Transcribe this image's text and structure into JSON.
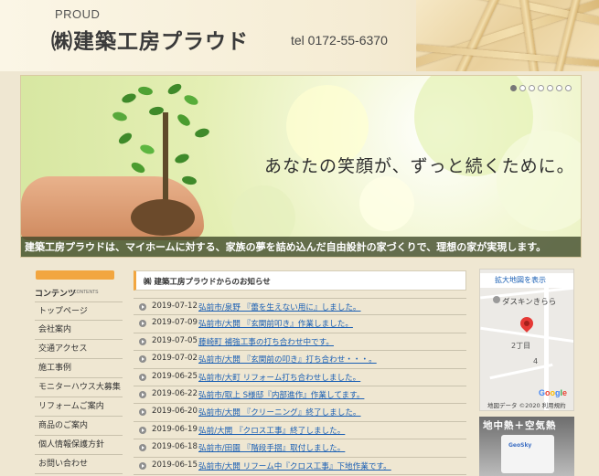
{
  "header": {
    "proud": "PROUD",
    "company": "㈱建築工房プラウド",
    "tel": "tel 0172-55-6370"
  },
  "hero": {
    "tagline": "あなたの笑顔が、ずっと続くために。",
    "strip": "建築工房プラウドは、マイホームに対する、家族の夢を詰め込んだ自由設計の家づくりで、理想の家が実現します。",
    "slide_count": 7,
    "active_slide": 1
  },
  "sidebar": {
    "heading": "コンテンツ",
    "heading_sub": "CONTENTS",
    "items": [
      {
        "label": "トップページ"
      },
      {
        "label": "会社案内"
      },
      {
        "label": "交通アクセス"
      },
      {
        "label": "施工事例"
      },
      {
        "label": "モニターハウス大募集"
      },
      {
        "label": "リフォームご案内"
      },
      {
        "label": "商品のご案内"
      },
      {
        "label": "個人情報保護方針"
      },
      {
        "label": "お問い合わせ"
      }
    ]
  },
  "news": {
    "title": "㈱ 建築工房プラウドからのお知らせ",
    "items": [
      {
        "date": "2019-07-12",
        "text": "弘前市/泉野 『蕾を生えない用に』しました。"
      },
      {
        "date": "2019-07-09",
        "text": "弘前市/大開 『玄関前叩き』作業しました。"
      },
      {
        "date": "2019-07-05",
        "text": "藤崎町 補強工事の打ち合わせ中です。"
      },
      {
        "date": "2019-07-02",
        "text": "弘前市/大開 『玄関前の叩き』打ち合わせ・・・。"
      },
      {
        "date": "2019-06-25",
        "text": "弘前市/大町 リフォーム打ち合わせしました。"
      },
      {
        "date": "2019-06-22",
        "text": "弘前市/取上 S様邸『内部進作』作業してます。"
      },
      {
        "date": "2019-06-20",
        "text": "弘前市/大開 『クリーニング』終了しました。"
      },
      {
        "date": "2019-06-19",
        "text": "弘前/大開 『クロス工事』終了しました。"
      },
      {
        "date": "2019-06-18",
        "text": "弘前市/田園 『階段手摺』取付しました。"
      },
      {
        "date": "2019-06-15",
        "text": "弘前市/大開 リフーム中『クロス工事』下地作業です。"
      }
    ]
  },
  "map": {
    "enlarge": "拡大地図を表示",
    "place": "ダスキンきらら",
    "chome": "2丁目",
    "number": "4",
    "logo": "Google",
    "credit": "地図データ ©2020  利用規約",
    "pin_color": "#e53935"
  },
  "ad": {
    "text": "地中熱＋空気熱",
    "unit_label": "GeoSky"
  },
  "colors": {
    "accent": "#f2a640",
    "link": "#1a5fb4",
    "strip_bg": "#3c4628"
  }
}
